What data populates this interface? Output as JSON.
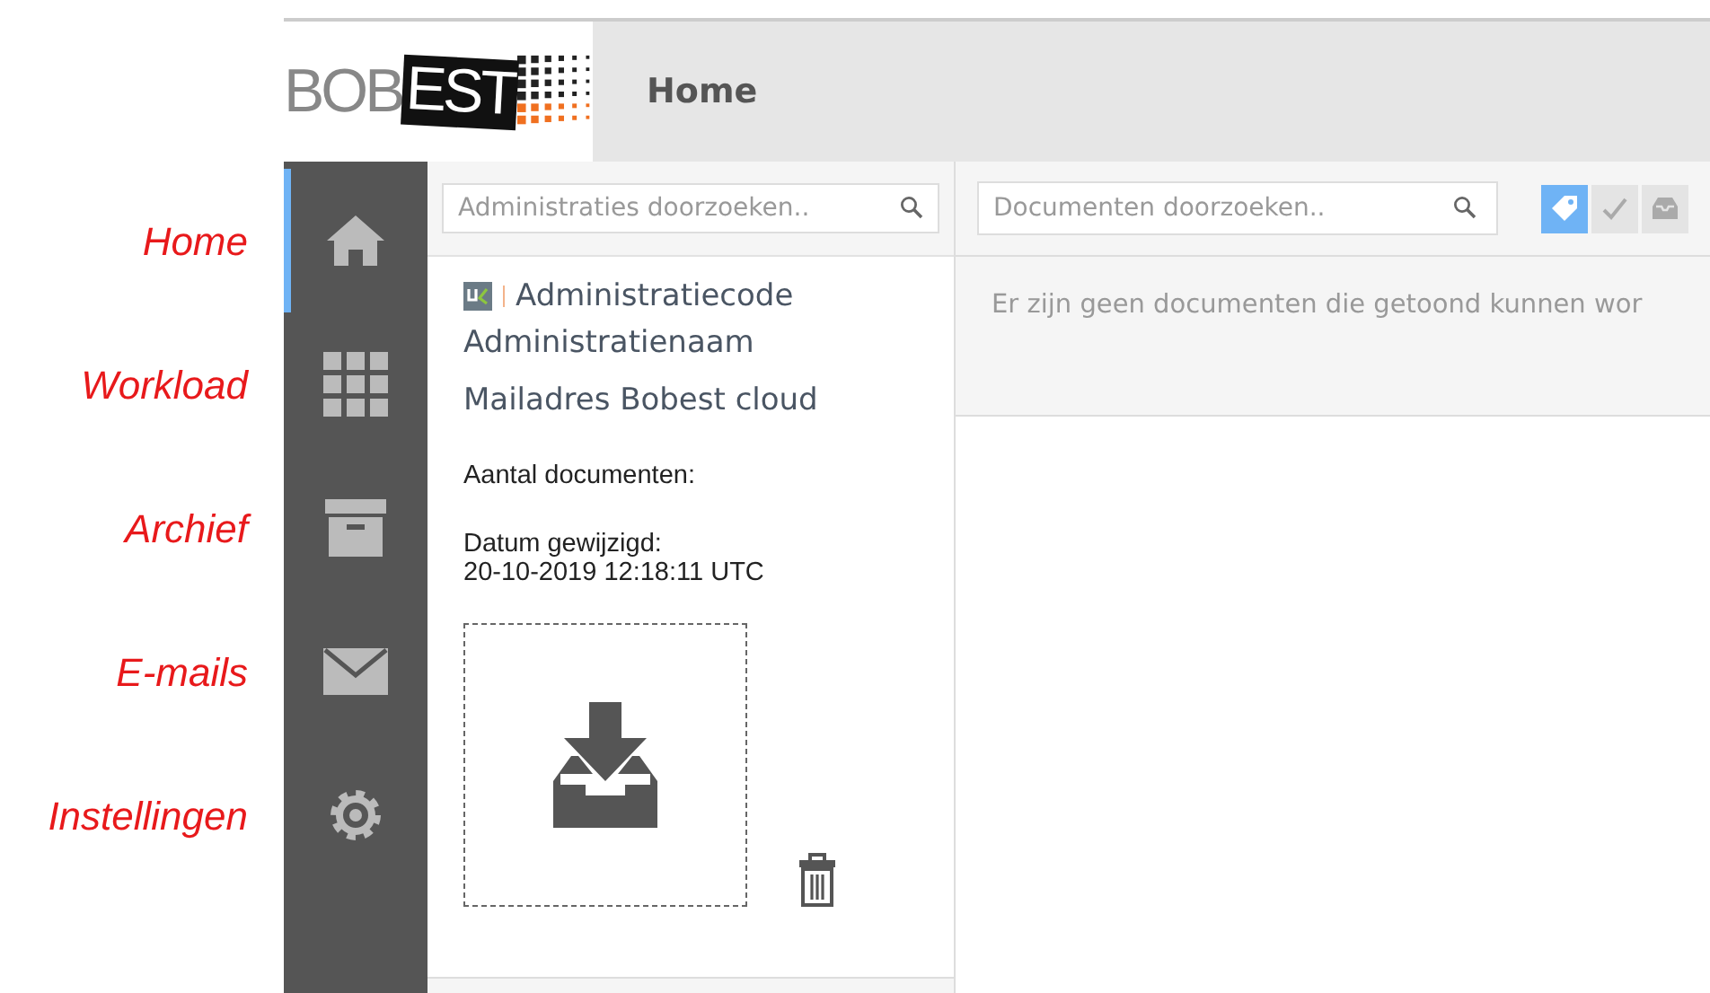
{
  "annotations": [
    {
      "label": "Home"
    },
    {
      "label": "Workload"
    },
    {
      "label": "Archief"
    },
    {
      "label": "E-mails"
    },
    {
      "label": "Instellingen"
    }
  ],
  "header": {
    "logo_left": "BOB",
    "logo_right": "EST",
    "title": "Home"
  },
  "sidebar": {
    "items": [
      {
        "kind": "home",
        "selected": true
      },
      {
        "kind": "grid",
        "selected": false
      },
      {
        "kind": "archive",
        "selected": false
      },
      {
        "kind": "mail",
        "selected": false
      },
      {
        "kind": "settings",
        "selected": false
      }
    ]
  },
  "administrations": {
    "search": {
      "placeholder": "Administraties doorzoeken.."
    },
    "card": {
      "code": "Administratiecode",
      "name": "Administratienaam",
      "email": "Mailadres Bobest cloud",
      "count_label": "Aantal documenten:",
      "date_label": "Datum gewijzigd:",
      "date": "20-10-2019 12:18:11 UTC"
    }
  },
  "documents": {
    "search": {
      "placeholder": "Documenten doorzoeken.."
    },
    "filters": [
      {
        "kind": "tag",
        "selected": true
      },
      {
        "kind": "check",
        "selected": false
      },
      {
        "kind": "inbox",
        "selected": false
      }
    ],
    "empty_message": "Er zijn geen documenten die getoond kunnen wor"
  }
}
